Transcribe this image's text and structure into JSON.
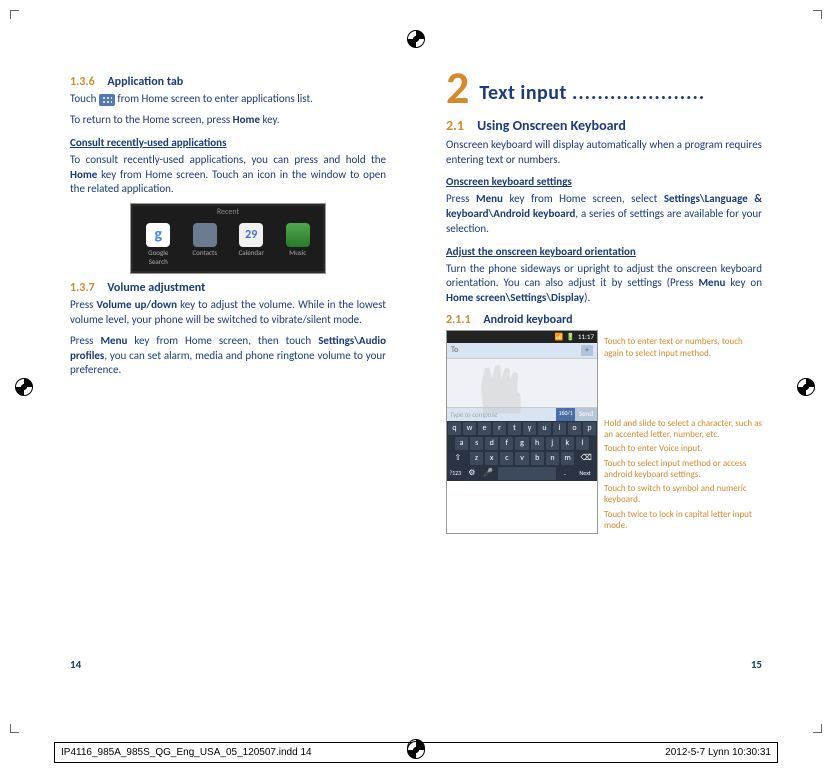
{
  "left": {
    "s136": {
      "num": "1.3.6",
      "title": "Application tab"
    },
    "s136_p1a": "Touch ",
    "s136_p1b": " from Home screen to enter applications list.",
    "s136_p2": "To return to the Home screen, press Home key.",
    "sub_consult": "Consult recently-used applications",
    "consult_p": "To consult recently-used applications, you can press and hold the Home key from Home screen. Touch an icon in the window to open the related application.",
    "recent": {
      "label": "Recent",
      "apps": [
        "Google Search",
        "Contacts",
        "Calendar",
        "Music"
      ],
      "cal_day": "29"
    },
    "s137": {
      "num": "1.3.7",
      "title": "Volume adjustment"
    },
    "s137_p1": "Press Volume up/down key to adjust the volume. While in the lowest volume level, your phone will be switched to vibrate/silent mode.",
    "s137_p2": "Press Menu key from Home screen, then touch Settings\\Audio profiles, you can set alarm, media and phone ringtone volume to your preference.",
    "page": "14"
  },
  "right": {
    "chapter": {
      "num": "2",
      "title": "Text input",
      "dots": "....................."
    },
    "s21": {
      "num": "2.1",
      "title": "Using Onscreen Keyboard"
    },
    "s21_p": "Onscreen keyboard will display automatically when a program requires entering text or numbers.",
    "sub_settings": "Onscreen keyboard settings",
    "settings_p": "Press Menu key from Home screen, select Settings\\Language & keyboard\\Android keyboard, a series of settings are available for your selection.",
    "sub_orient": "Adjust the onscreen keyboard orientation",
    "orient_p": "Turn the phone sideways or upright to adjust the onscreen keyboard orientation. You can also adjust it by settings (Press Menu key on Home screen\\Settings\\Display).",
    "s211": {
      "num": "2.1.1",
      "title": "Android keyboard"
    },
    "kb": {
      "time": "11:17",
      "to": "To",
      "compose": "Type to compose",
      "count": "160/1",
      "send": "Send",
      "next": "Next",
      "sym": "?123",
      "rows": [
        [
          "q",
          "w",
          "e",
          "r",
          "t",
          "y",
          "u",
          "i",
          "o",
          "p"
        ],
        [
          "a",
          "s",
          "d",
          "f",
          "g",
          "h",
          "j",
          "k",
          "l"
        ],
        [
          "⇧",
          "z",
          "x",
          "c",
          "v",
          "b",
          "n",
          "m",
          "⌫"
        ]
      ]
    },
    "annot": {
      "a1": "Touch to enter text or numbers, touch again to select input method.",
      "a2": "Hold and slide to select a character, such as an accented letter, number, etc.",
      "a3": "Touch to enter Voice input.",
      "a4": "Touch to select input method or access android keyboard settings.",
      "a5": "Touch to switch to symbol and numeric keyboard.",
      "a6": "Touch twice to lock in capital letter input mode."
    },
    "page": "15"
  },
  "footer": {
    "file": "IP4116_985A_985S_QG_Eng_USA_05_120507.indd   14",
    "date": "2012-5-7   Lynn 10:30:31"
  }
}
